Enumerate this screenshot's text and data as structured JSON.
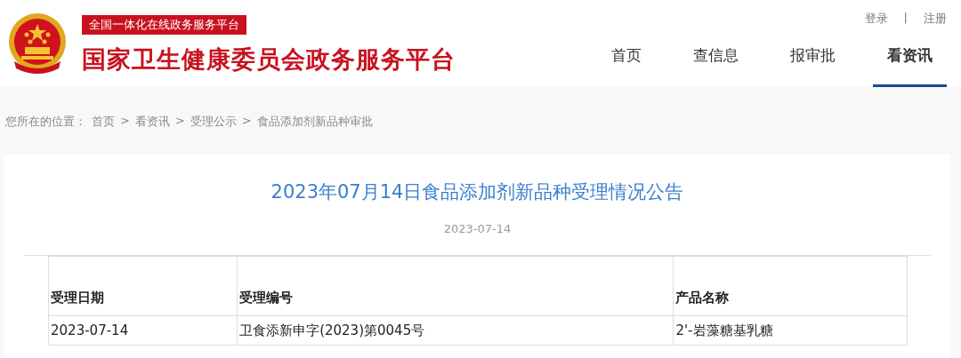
{
  "header": {
    "tagline": "全国一体化在线政务服务平台",
    "site_title": "国家卫生健康委员会政务服务平台",
    "account_links": [
      "登录",
      "|",
      "注册"
    ],
    "nav": [
      {
        "label": "首页",
        "selected": false
      },
      {
        "label": "查信息",
        "selected": false
      },
      {
        "label": "报审批",
        "selected": false
      },
      {
        "label": "看资讯",
        "selected": true
      }
    ]
  },
  "breadcrumb": {
    "prefix": "您所在的位置：",
    "items": [
      "首页",
      "看资讯",
      "受理公示",
      "食品添加剂新品种审批"
    ],
    "separator": ">"
  },
  "article": {
    "title": "2023年07月14日食品添加剂新品种受理情况公告",
    "date": "2023-07-14",
    "table": {
      "columns": [
        "受理日期",
        "受理编号",
        "产品名称"
      ],
      "rows": [
        [
          "2023-07-14",
          "卫食添新申字(2023)第0045号",
          "2'-岩藻糖基乳糖"
        ]
      ]
    }
  }
}
